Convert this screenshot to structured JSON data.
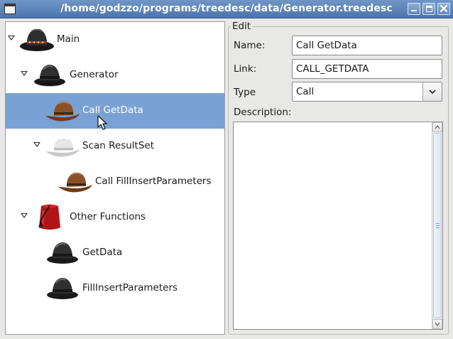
{
  "window": {
    "title": "/home/godzzo/programs/treedesc/data/Generator.treedesc"
  },
  "tree": {
    "items": [
      {
        "label": "Main",
        "icon": "black-cowboy-hat-icon",
        "level": 0,
        "expanded": true,
        "selected": false
      },
      {
        "label": "Generator",
        "icon": "black-bowler-hat-icon",
        "level": 1,
        "expanded": true,
        "selected": false
      },
      {
        "label": "Call GetData",
        "icon": "brown-cowboy-hat-icon",
        "level": 2,
        "expanded": null,
        "selected": true
      },
      {
        "label": "Scan ResultSet",
        "icon": "white-cowboy-hat-icon",
        "level": 2,
        "expanded": true,
        "selected": false
      },
      {
        "label": "Call FillInsertParameters",
        "icon": "brown-cowboy-hat-icon",
        "level": 3,
        "expanded": null,
        "selected": false
      },
      {
        "label": "Other Functions",
        "icon": "red-fez-hat-icon",
        "level": 1,
        "expanded": true,
        "selected": false
      },
      {
        "label": "GetData",
        "icon": "black-bowler-hat-icon",
        "level": 2,
        "expanded": null,
        "selected": false
      },
      {
        "label": "FillInsertParameters",
        "icon": "black-bowler-hat-icon",
        "level": 2,
        "expanded": null,
        "selected": false
      }
    ]
  },
  "edit": {
    "group_title": "Edit",
    "name_label": "Name:",
    "name_value": "Call GetData",
    "link_label": "Link:",
    "link_value": "CALL_GETDATA",
    "type_label": "Type",
    "type_value": "Call",
    "description_label": "Description:",
    "description_value": ""
  },
  "colors": {
    "titlebar": "#5a80b6",
    "selection": "#7aa1d3",
    "window_bg": "#e8e8e7"
  }
}
